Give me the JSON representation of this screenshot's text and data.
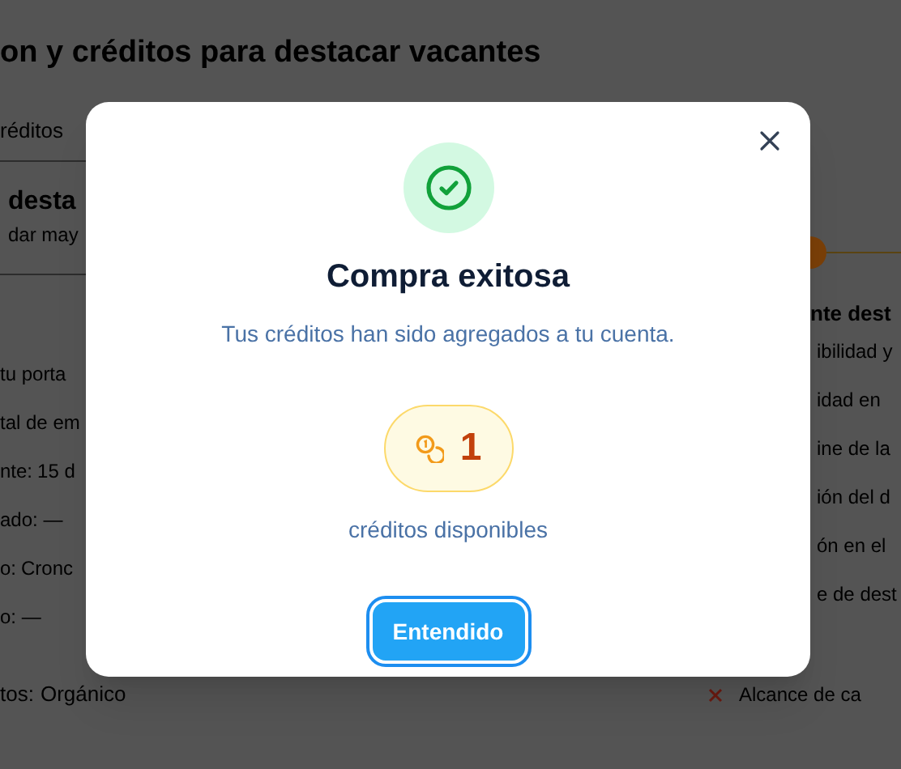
{
  "page": {
    "title": "on y créditos para destacar vacantes",
    "tab": "réditos"
  },
  "left_card": {
    "title": "desta",
    "subtitle": "dar may",
    "rows": [
      {
        "label": "tu porta"
      },
      {
        "label": "tal de em"
      },
      {
        "label": "nte:",
        "value": "15 d"
      },
      {
        "label": "ado: —"
      },
      {
        "label": "o:",
        "value": "Cronc"
      },
      {
        "label": "o: —"
      }
    ],
    "last_row": {
      "label": "tos:",
      "value": "Orgánico"
    }
  },
  "right_card": {
    "title": "nte dest",
    "items": [
      "ibilidad y",
      "idad en",
      "ine de la",
      "ión del d",
      "ón en el",
      "e de dest"
    ],
    "last_item": "Alcance de ca"
  },
  "dialog": {
    "title": "Compra exitosa",
    "message": "Tus créditos han sido agregados a tu cuenta.",
    "credits": "1",
    "credits_label": "créditos disponibles",
    "button": "Entendido"
  }
}
